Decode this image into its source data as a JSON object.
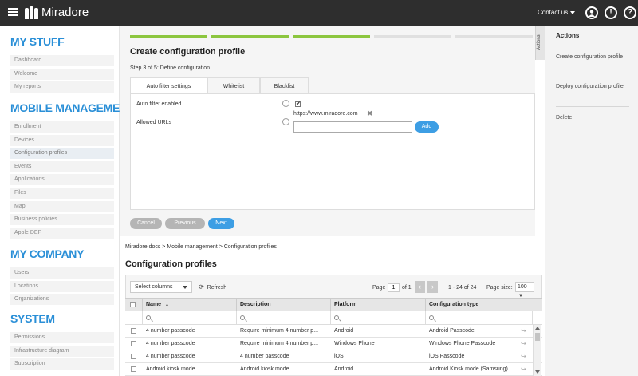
{
  "header": {
    "logo_text": "Miradore",
    "contact_label": "Contact us",
    "icons": [
      "menu-icon",
      "user-icon",
      "alert-icon",
      "help-icon"
    ]
  },
  "sidebar": {
    "sections": [
      {
        "title": "MY STUFF",
        "items": [
          "Dashboard",
          "Welcome",
          "My reports"
        ]
      },
      {
        "title": "MOBILE MANAGEMENT",
        "items": [
          "Enrollment",
          "Devices",
          "Configuration profiles",
          "Events",
          "Applications",
          "Files",
          "Map",
          "Business policies",
          "Apple DEP"
        ]
      },
      {
        "title": "MY COMPANY",
        "items": [
          "Users",
          "Locations",
          "Organizations"
        ]
      },
      {
        "title": "SYSTEM",
        "items": [
          "Permissions",
          "Infrastructure diagram",
          "Subscription"
        ]
      }
    ],
    "active_item": "Configuration profiles"
  },
  "wizard": {
    "title": "Create configuration profile",
    "step_text": "Step 3 of 5: Define configuration",
    "progress": {
      "completed_steps": 3,
      "total_steps": 5
    },
    "tabs": [
      "Auto filter settings",
      "Whitelist",
      "Blacklist"
    ],
    "active_tab": "Auto filter settings",
    "fields": {
      "auto_filter_label": "Auto filter enabled",
      "auto_filter_checked": "✔",
      "allowed_urls_label": "Allowed URLs",
      "url_entry": "https://www.miradore.com",
      "url_input_value": "",
      "add_label": "Add"
    },
    "buttons": {
      "cancel": "Cancel",
      "previous": "Previous",
      "next": "Next"
    }
  },
  "actions_tab_label": "Actions",
  "actions_panel": {
    "title": "Actions",
    "items": [
      "Create configuration profile",
      "Deploy configuration profile",
      "Delete"
    ]
  },
  "breadcrumb": "Miradore docs > Mobile management > Configuration profiles",
  "grid": {
    "title": "Configuration profiles",
    "select_columns": "Select columns",
    "refresh": "Refresh",
    "page_label": "Page",
    "page_value": "1",
    "of_label": "of 1",
    "range": "1 - 24 of 24",
    "page_size_label": "Page size:",
    "page_size_value": "100",
    "columns": [
      "Name",
      "Description",
      "Platform",
      "Configuration type"
    ],
    "sort_indicator": "▲",
    "rows": [
      [
        "4 number passcode",
        "Require minimum 4 number p...",
        "Android",
        "Android Passcode"
      ],
      [
        "4 number passcode",
        "Require minimum 4 number p...",
        "Windows Phone",
        "Windows Phone Passcode"
      ],
      [
        "4 number passcode",
        "4 number passcode",
        "iOS",
        "iOS Passcode"
      ],
      [
        "Android kiosk mode",
        "Android kiosk mode",
        "Android",
        "Android Kiosk mode (Samsung)"
      ]
    ]
  },
  "colors": {
    "accent_blue": "#2a8fd7",
    "progress_green": "#8cc63f",
    "header_bg": "#2e2e2e"
  }
}
